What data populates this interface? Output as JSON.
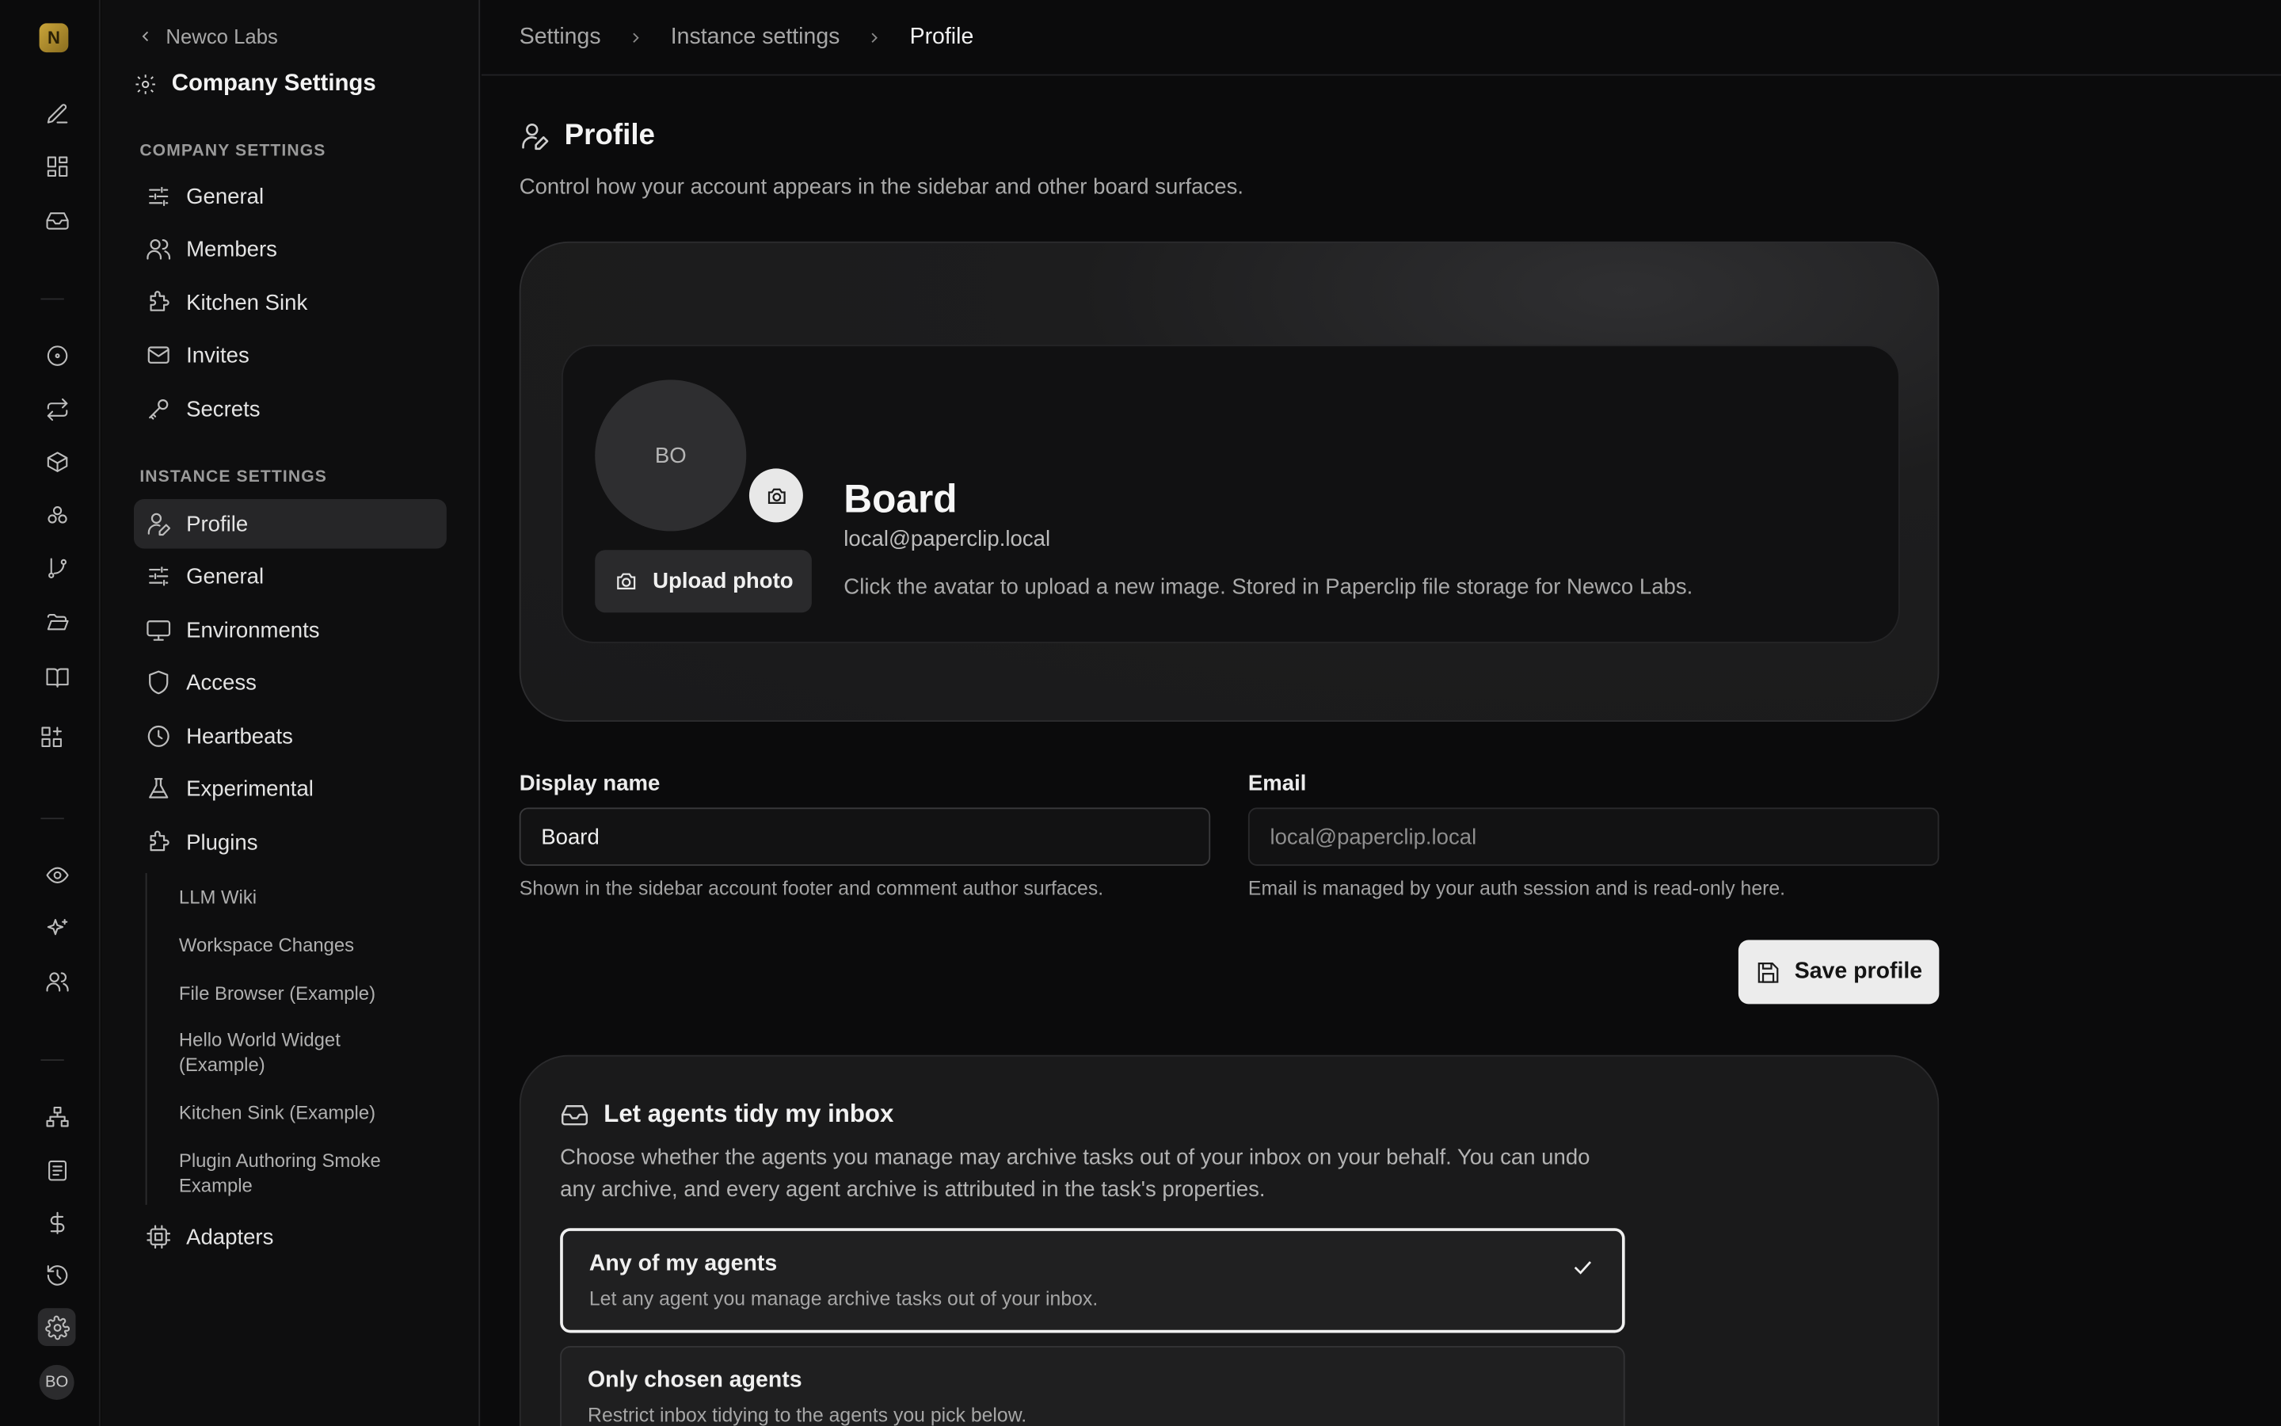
{
  "rail": {
    "logo_letter": "N",
    "user_initials": "BO"
  },
  "sidebar": {
    "back_label": "Newco Labs",
    "title": "Company Settings",
    "company_section": "COMPANY SETTINGS",
    "company_items": [
      {
        "label": "General",
        "icon": "sliders-icon"
      },
      {
        "label": "Members",
        "icon": "users-icon"
      },
      {
        "label": "Kitchen Sink",
        "icon": "puzzle-icon"
      },
      {
        "label": "Invites",
        "icon": "mail-icon"
      },
      {
        "label": "Secrets",
        "icon": "key-icon"
      }
    ],
    "instance_section": "INSTANCE SETTINGS",
    "instance_items": [
      {
        "label": "Profile",
        "icon": "user-pen-icon"
      },
      {
        "label": "General",
        "icon": "sliders-icon"
      },
      {
        "label": "Environments",
        "icon": "monitor-icon"
      },
      {
        "label": "Access",
        "icon": "shield-icon"
      },
      {
        "label": "Heartbeats",
        "icon": "clock-icon"
      },
      {
        "label": "Experimental",
        "icon": "flask-icon"
      },
      {
        "label": "Plugins",
        "icon": "puzzle-icon"
      }
    ],
    "plugins": [
      "LLM Wiki",
      "Workspace Changes",
      "File Browser (Example)",
      "Hello World Widget (Example)",
      "Kitchen Sink (Example)",
      "Plugin Authoring Smoke Example"
    ],
    "adapters_label": "Adapters"
  },
  "breadcrumb": [
    "Settings",
    "Instance settings",
    "Profile"
  ],
  "page": {
    "title": "Profile",
    "description": "Control how your account appears in the sidebar and other board surfaces."
  },
  "profile_card": {
    "initials": "BO",
    "upload_label": "Upload photo",
    "name": "Board",
    "email": "local@paperclip.local",
    "note": "Click the avatar to upload a new image. Stored in Paperclip file storage for Newco Labs."
  },
  "form": {
    "display_name_label": "Display name",
    "display_name_value": "Board",
    "display_name_help": "Shown in the sidebar account footer and comment author surfaces.",
    "email_label": "Email",
    "email_value": "local@paperclip.local",
    "email_help": "Email is managed by your auth session and is read-only here.",
    "save_label": "Save profile"
  },
  "inbox": {
    "title": "Let agents tidy my inbox",
    "description": "Choose whether the agents you manage may archive tasks out of your inbox on your behalf. You can undo any archive, and every agent archive is attributed in the task's properties.",
    "options": [
      {
        "title": "Any of my agents",
        "sub": "Let any agent you manage archive tasks out of your inbox.",
        "selected": true
      },
      {
        "title": "Only chosen agents",
        "sub": "Restrict inbox tidying to the agents you pick below.",
        "selected": false
      }
    ]
  }
}
